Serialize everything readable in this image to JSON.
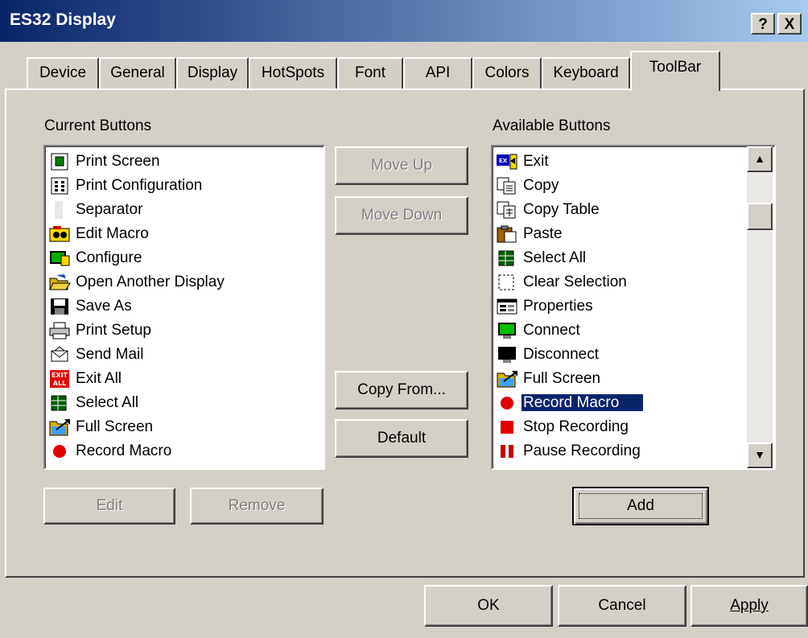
{
  "window": {
    "title": "ES32 Display",
    "help_button": "?",
    "close_button": "X"
  },
  "tabs": [
    "Device",
    "General",
    "Display",
    "HotSpots",
    "Font",
    "API",
    "Colors",
    "Keyboard",
    "ToolBar"
  ],
  "active_tab": "ToolBar",
  "current_buttons": {
    "label": "Current Buttons",
    "items": [
      {
        "label": "Print Screen",
        "icon": "print-screen-icon"
      },
      {
        "label": "Print Configuration",
        "icon": "print-config-icon"
      },
      {
        "label": "Separator",
        "icon": "separator-icon"
      },
      {
        "label": "Edit Macro",
        "icon": "edit-macro-icon"
      },
      {
        "label": "Configure",
        "icon": "configure-icon"
      },
      {
        "label": "Open Another Display",
        "icon": "open-folder-icon"
      },
      {
        "label": "Save As",
        "icon": "floppy-icon"
      },
      {
        "label": "Print Setup",
        "icon": "printer-icon"
      },
      {
        "label": "Send Mail",
        "icon": "envelope-icon"
      },
      {
        "label": "Exit All",
        "icon": "exit-all-icon"
      },
      {
        "label": "Select All",
        "icon": "select-all-icon"
      },
      {
        "label": "Full Screen",
        "icon": "full-screen-icon"
      },
      {
        "label": "Record Macro",
        "icon": "record-icon"
      }
    ]
  },
  "middle_buttons": {
    "move_up": "Move Up",
    "move_down": "Move Down",
    "copy_from": "Copy From...",
    "default": "Default"
  },
  "available_buttons": {
    "label": "Available Buttons",
    "selected": "Record Macro",
    "items": [
      {
        "label": "Exit",
        "icon": "exit-icon"
      },
      {
        "label": "Copy",
        "icon": "copy-icon"
      },
      {
        "label": "Copy Table",
        "icon": "copy-table-icon"
      },
      {
        "label": "Paste",
        "icon": "paste-icon"
      },
      {
        "label": "Select All",
        "icon": "select-all-icon"
      },
      {
        "label": "Clear Selection",
        "icon": "clear-selection-icon"
      },
      {
        "label": "Properties",
        "icon": "properties-icon"
      },
      {
        "label": "Connect",
        "icon": "connect-icon"
      },
      {
        "label": "Disconnect",
        "icon": "disconnect-icon"
      },
      {
        "label": "Full Screen",
        "icon": "full-screen-icon"
      },
      {
        "label": "Record Macro",
        "icon": "record-icon"
      },
      {
        "label": "Stop Recording",
        "icon": "stop-icon"
      },
      {
        "label": "Pause Recording",
        "icon": "pause-icon"
      }
    ]
  },
  "edit_button": "Edit",
  "remove_button": "Remove",
  "add_button": "Add",
  "dialog_buttons": {
    "ok": "OK",
    "cancel": "Cancel",
    "apply": "Apply"
  },
  "colors": {
    "title_start": "#0a246a",
    "title_end": "#a6caf0",
    "selection": "#0a246a",
    "face": "#d4d0c8"
  }
}
